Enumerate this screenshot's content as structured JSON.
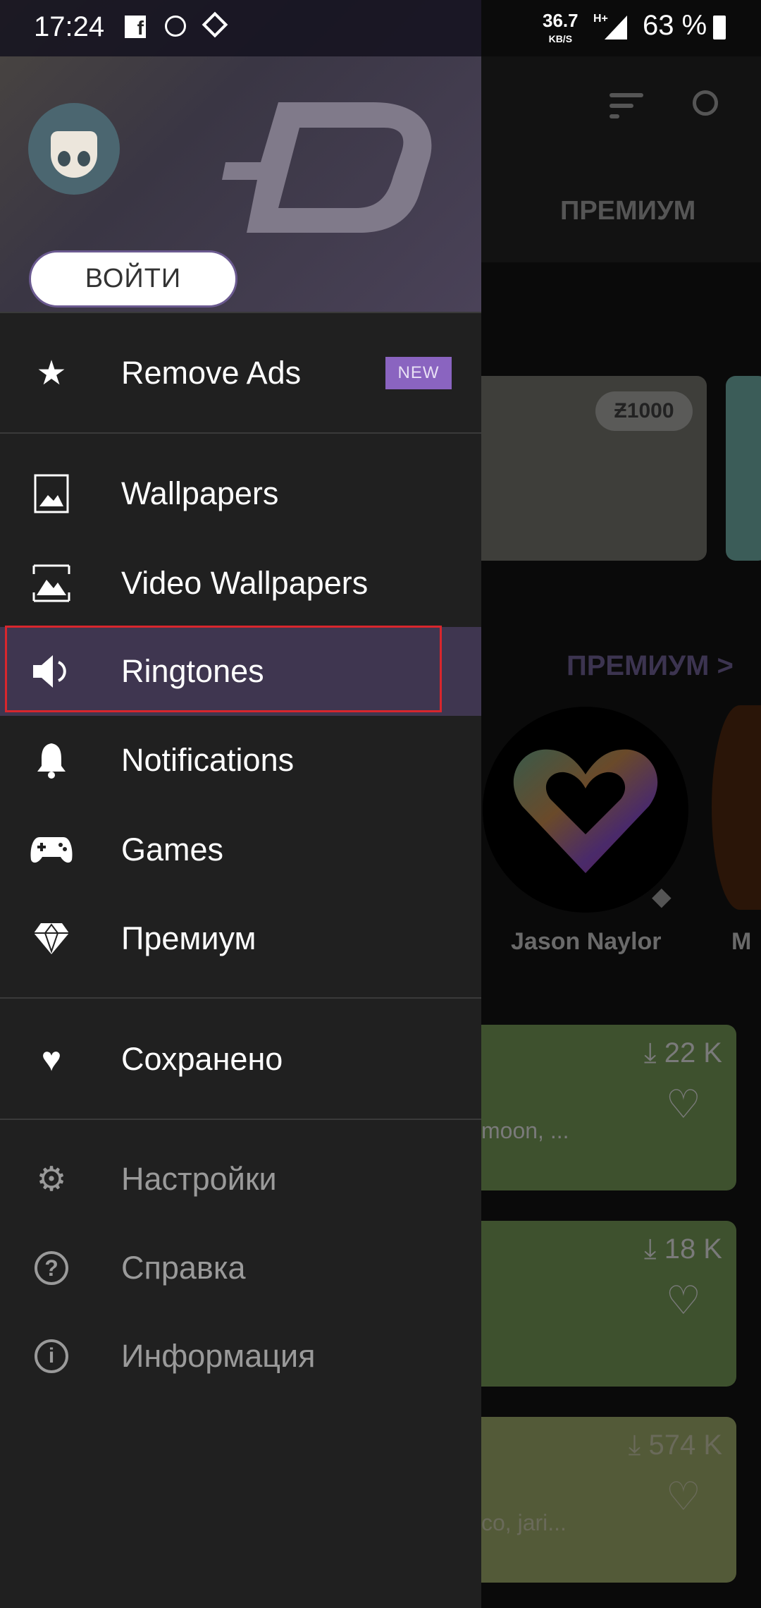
{
  "status_bar": {
    "time": "17:24",
    "net_speed": "36.7",
    "net_unit": "KB/S",
    "network": "H+",
    "battery": "63 %"
  },
  "background": {
    "tab": "ПРЕМИУМ",
    "coin_badge": "Ƶ1000",
    "premium_link": "ПРЕМИУМ >",
    "artist": "Jason Naylor",
    "artist2_initial": "M",
    "list": [
      {
        "downloads": "22 K",
        "tags": "moon, ..."
      },
      {
        "downloads": "18 K",
        "tags": ""
      },
      {
        "downloads": "574 K",
        "tags": "co, jari..."
      }
    ]
  },
  "drawer": {
    "login_label": "ВОЙТИ",
    "remove_ads": {
      "label": "Remove Ads",
      "badge": "NEW"
    },
    "items": [
      {
        "label": "Wallpapers",
        "icon": "image-icon"
      },
      {
        "label": "Video Wallpapers",
        "icon": "video-wallpaper-icon"
      },
      {
        "label": "Ringtones",
        "icon": "speaker-icon",
        "selected": true
      },
      {
        "label": "Notifications",
        "icon": "bell-icon"
      },
      {
        "label": "Games",
        "icon": "gamepad-icon"
      },
      {
        "label": "Премиум",
        "icon": "diamond-icon"
      }
    ],
    "saved": {
      "label": "Сохранено",
      "icon": "heart-icon"
    },
    "secondary": [
      {
        "label": "Настройки",
        "icon": "gear-icon"
      },
      {
        "label": "Справка",
        "icon": "help-icon"
      },
      {
        "label": "Информация",
        "icon": "info-icon"
      }
    ]
  },
  "colors": {
    "accent": "#8a64c0",
    "selected_bg": "#3f3650",
    "highlight_box": "#d8262d"
  }
}
